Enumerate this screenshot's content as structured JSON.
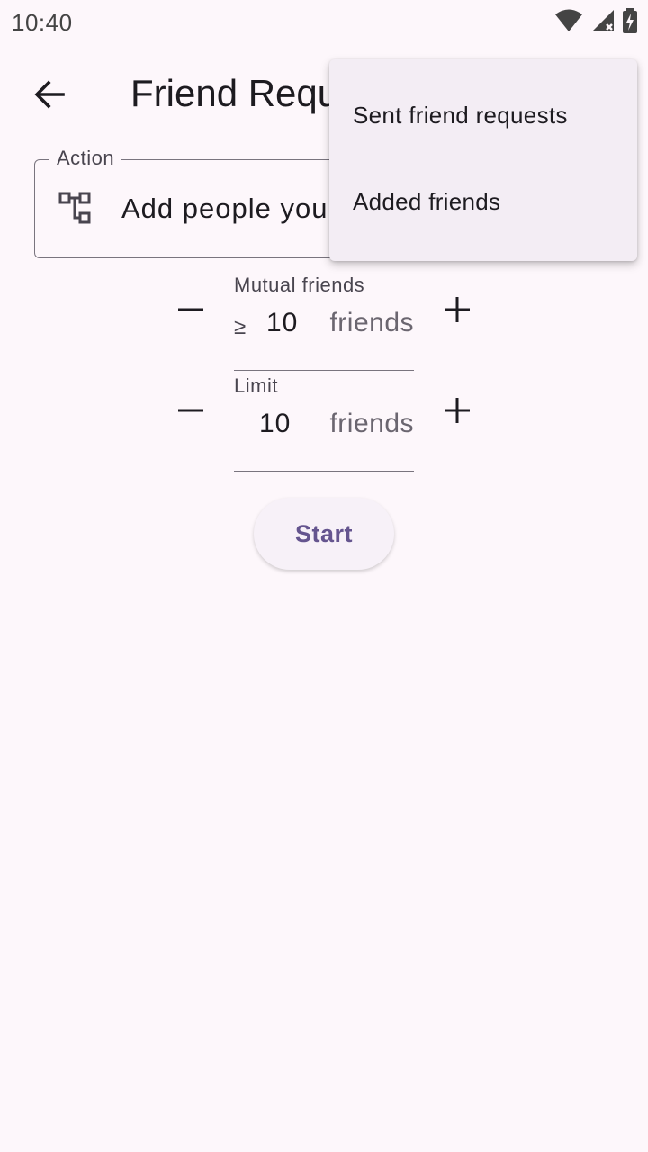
{
  "status_bar": {
    "time": "10:40",
    "icons": [
      "wifi-icon",
      "cell-signal-icon",
      "battery-charging-icon"
    ]
  },
  "app_bar": {
    "back_icon": "arrow-back-icon",
    "title": "Friend Requests"
  },
  "action": {
    "label": "Action",
    "icon": "hierarchy-icon",
    "value": "Add people you may know"
  },
  "mutual_friends": {
    "label": "Mutual friends",
    "prefix": "≥",
    "value": "10",
    "suffix": "friends"
  },
  "limit": {
    "label": "Limit",
    "value": "10",
    "suffix": "friends"
  },
  "start_button": {
    "label": "Start"
  },
  "popup_menu": {
    "items": [
      "Sent friend requests",
      "Added friends"
    ]
  },
  "colors": {
    "background": "#fdf7fb",
    "primary": "#65558f",
    "menu_surface": "#f3edf4"
  }
}
